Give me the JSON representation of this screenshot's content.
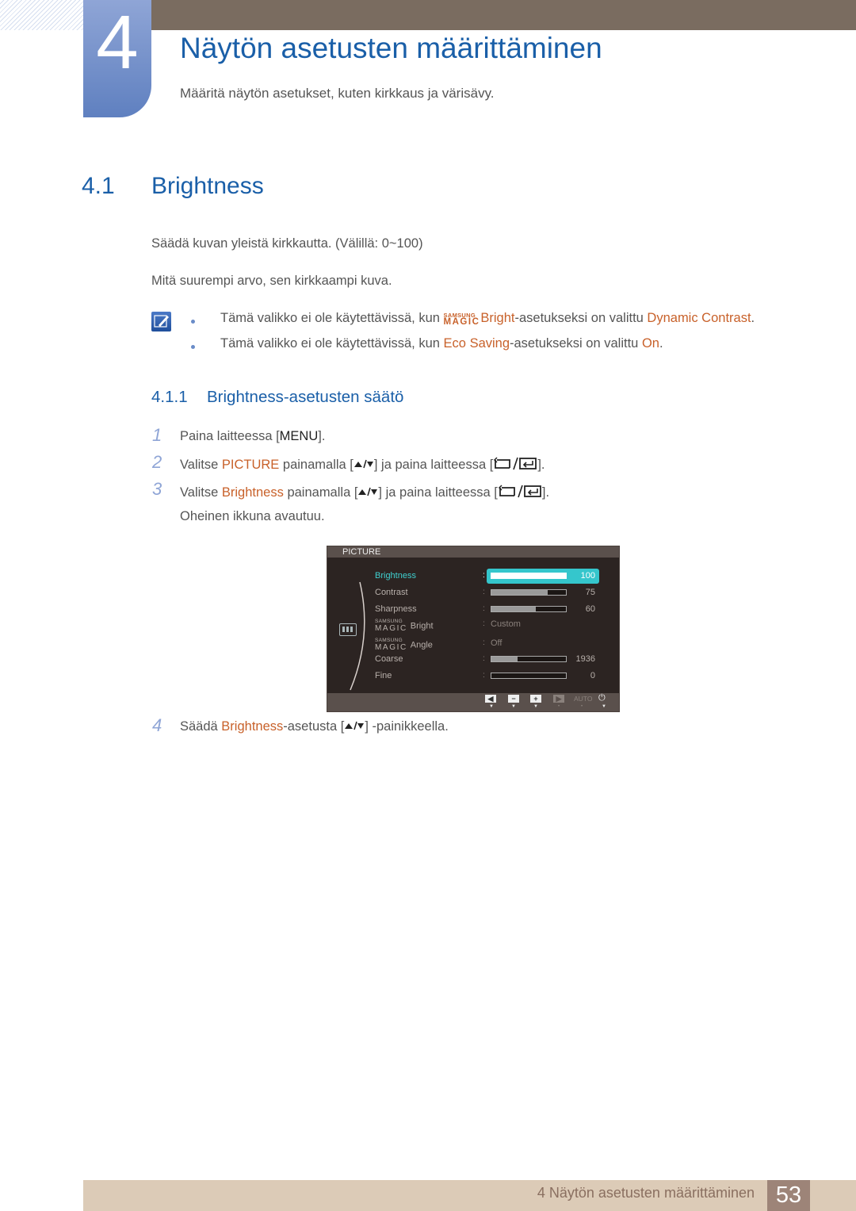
{
  "chapter": {
    "number": "4",
    "title": "Näytön asetusten määrittäminen",
    "subtitle": "Määritä näytön asetukset, kuten kirkkaus ja värisävy."
  },
  "section": {
    "number": "4.1",
    "title": "Brightness",
    "paragraphs": [
      "Säädä kuvan yleistä kirkkautta. (Välillä: 0~100)",
      "Mitä suurempi arvo, sen kirkkaampi kuva."
    ],
    "notes": [
      {
        "prefix": "Tämä valikko ei ole käytettävissä, kun ",
        "magic_small": "SAMSUNG",
        "magic_big": "MAGIC",
        "highlight": "Bright",
        "middle": "-asetukseksi on valittu ",
        "value": "Dynamic Contrast",
        "end": "."
      },
      {
        "prefix": "Tämä valikko ei ole käytettävissä, kun ",
        "highlight": "Eco Saving",
        "middle": "-asetukseksi on valittu ",
        "value": "On",
        "end": "."
      }
    ]
  },
  "subsection": {
    "number": "4.1.1",
    "title": "Brightness-asetusten säätö"
  },
  "steps": [
    {
      "num": "1",
      "a": "Paina laitteessa [",
      "key": "MENU",
      "b": "]."
    },
    {
      "num": "2",
      "a": "Valitse ",
      "hl": "PICTURE",
      "b": " painamalla [",
      "c": "] ja paina laitteessa [",
      "d": "]."
    },
    {
      "num": "3",
      "a": "Valitse ",
      "hl": "Brightness",
      "b": " painamalla [",
      "c": "] ja paina laitteessa [",
      "d": "]."
    },
    {
      "followup": "Oheinen ikkuna avautuu."
    },
    {
      "num": "4",
      "a": "Säädä ",
      "hl": "Brightness",
      "b": "-asetusta [",
      "c": "] -painikkeella."
    }
  ],
  "osd": {
    "header": "PICTURE",
    "items": [
      {
        "label": "Brightness",
        "type": "bar",
        "value": 100,
        "max": 100,
        "active": true
      },
      {
        "label": "Contrast",
        "type": "bar",
        "value": 75,
        "max": 100
      },
      {
        "label": "Sharpness",
        "type": "bar",
        "value": 60,
        "max": 100
      },
      {
        "label_small": "SAMSUNG",
        "label_big": "MAGIC",
        "label": "Bright",
        "type": "text",
        "value": "Custom"
      },
      {
        "label_small": "SAMSUNG",
        "label_big": "MAGIC",
        "label": "Angle",
        "type": "text",
        "value": "Off"
      },
      {
        "label": "Coarse",
        "type": "bar",
        "value": 1936,
        "fill_fraction": 0.35
      },
      {
        "label": "Fine",
        "type": "bar",
        "value": 0,
        "fill_fraction": 0
      }
    ],
    "buttons": [
      "left",
      "minus",
      "plus",
      "play",
      "AUTO",
      "power"
    ],
    "auto_label": "AUTO"
  },
  "footer": {
    "chapter_title": "4 Näytön asetusten määrittäminen",
    "page": "53"
  },
  "colors": {
    "heading_blue": "#1a5fa8",
    "accent_orange": "#c8612a",
    "osd_highlight": "#35c6cc",
    "topbar": "#7a6c60",
    "footer_bg": "#dccbb7",
    "page_box": "#9d8478"
  }
}
